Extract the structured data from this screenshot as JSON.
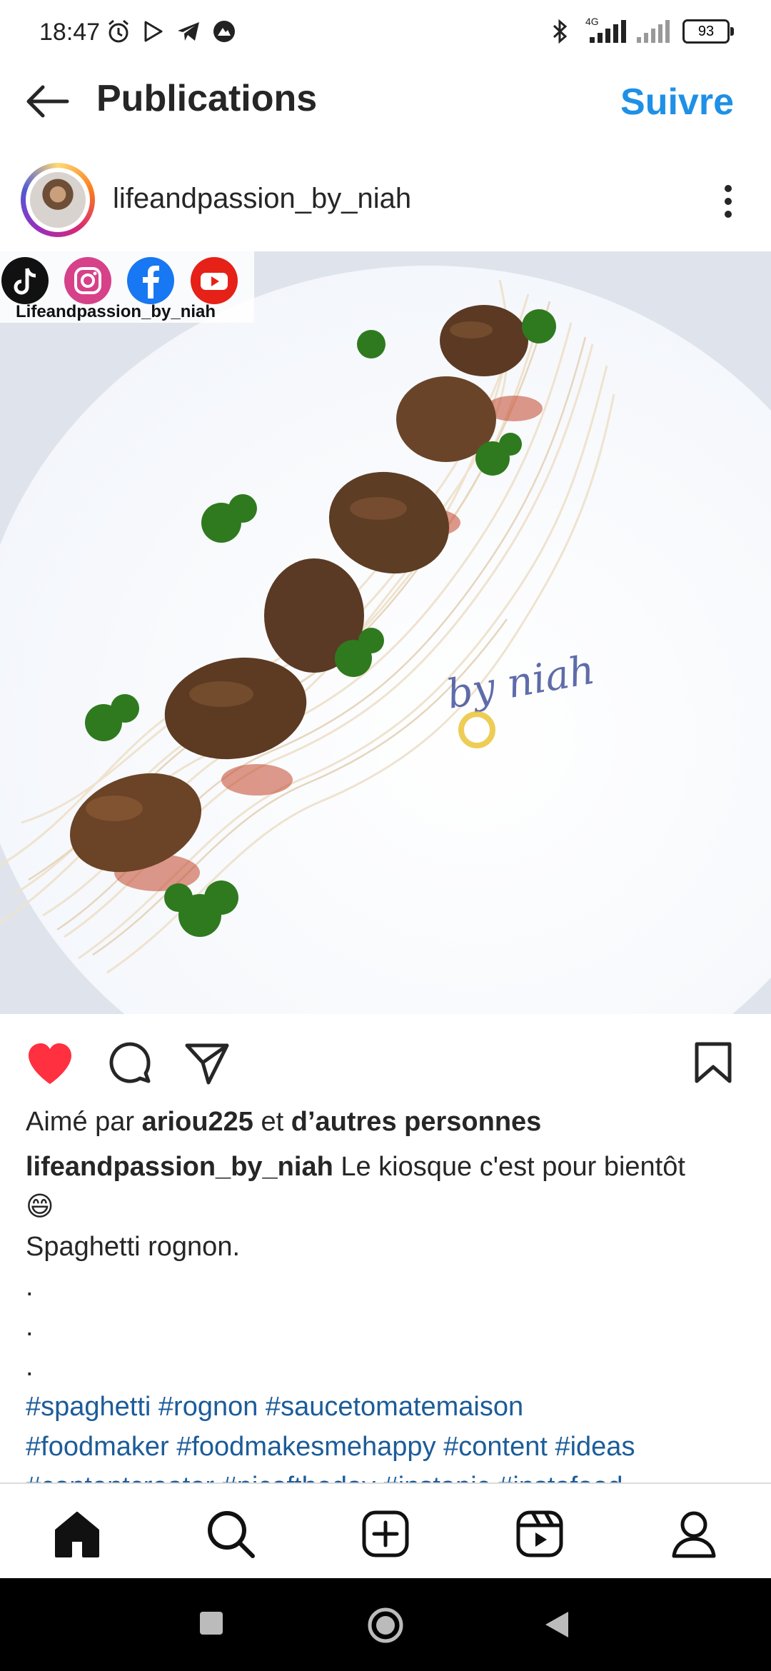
{
  "status_bar": {
    "time": "18:47",
    "network": "4G",
    "battery": "93"
  },
  "header": {
    "title": "Publications",
    "follow_label": "Suivre"
  },
  "post": {
    "username": "lifeandpassion_by_niah",
    "image": {
      "social_label": "Lifeandpassion_by_niah",
      "watermark": "by niah"
    },
    "liked": true,
    "likes_prefix": "Aimé par ",
    "likes_user": "ariou225",
    "likes_middle": " et ",
    "likes_others": "d’autres personnes",
    "caption_user": "lifeandpassion_by_niah",
    "caption_text": " Le kiosque c'est pour bientôt",
    "caption_emoji": "😄",
    "caption_line2": "Spaghetti rognon.",
    "dots": [
      ".",
      ".",
      "."
    ],
    "hashtags_line1": "#spaghetti #rognon #saucetomatemaison",
    "hashtags_line2": "#foodmaker #foodmakesmehappy #content #ideas",
    "hashtags_line3": "#contentcreator #picoftheday #instapic #instafood"
  },
  "colors": {
    "accent": "#1e90e6",
    "like": "#ff3040",
    "hashtag": "#1c5c99"
  },
  "icons": {
    "back": "arrow-left-icon",
    "more": "more-vertical-icon",
    "like": "heart-icon",
    "comment": "comment-icon",
    "share": "send-icon",
    "save": "bookmark-icon",
    "nav": [
      "home-icon",
      "search-icon",
      "create-icon",
      "reels-icon",
      "profile-icon"
    ]
  }
}
